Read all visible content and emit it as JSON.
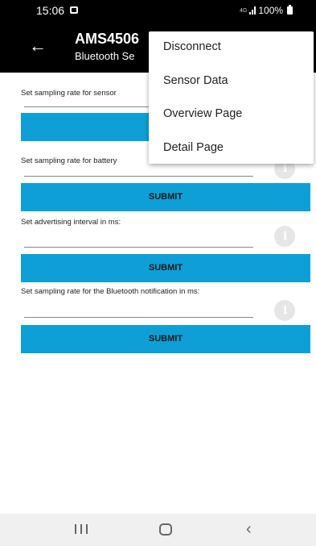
{
  "status_bar": {
    "time": "15:06",
    "network": "4G",
    "battery": "100%"
  },
  "app_bar": {
    "title": "AMS4506",
    "subtitle": "Bluetooth Se"
  },
  "form": {
    "sensor_label": "Set sampling rate for sensor",
    "battery_label": "Set sampling rate for battery",
    "advertising_label": "Set advertising interval in ms:",
    "notification_label": "Set sampling rate for the Bluetooth notification in ms:",
    "submit_partial": "SUB",
    "submit_label": "SUBMIT"
  },
  "menu": {
    "items": [
      "Disconnect",
      "Sensor Data",
      "Overview Page",
      "Detail Page"
    ]
  },
  "colors": {
    "accent": "#0e9fd6",
    "bar": "#000000"
  }
}
